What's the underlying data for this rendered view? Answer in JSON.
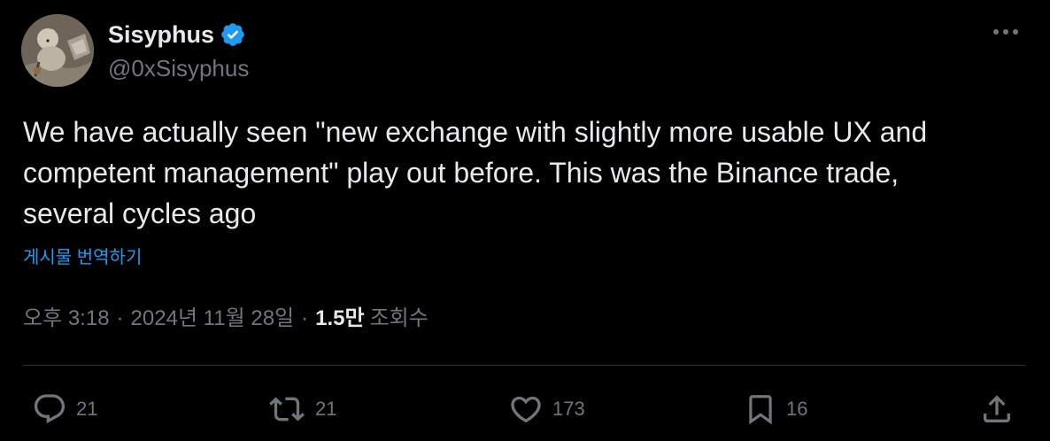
{
  "author": {
    "display_name": "Sisyphus",
    "handle": "@0xSisyphus",
    "verified": true,
    "avatar_icon": "avatar-illustration"
  },
  "tweet": {
    "text": "We have actually seen \"new exchange with slightly more usable UX and\ncompetent management\" play out before. This was the Binance trade,\nseveral cycles ago",
    "translate_label": "게시물 번역하기"
  },
  "meta": {
    "time": "오후 3:18",
    "separator": "·",
    "date": "2024년 11월 28일",
    "views_count": "1.5만",
    "views_label": "조회수"
  },
  "actions": {
    "reply_count": "21",
    "repost_count": "21",
    "like_count": "173",
    "bookmark_count": "16"
  },
  "colors": {
    "background": "#000000",
    "text_primary": "#e7e9ea",
    "text_secondary": "#71767b",
    "accent": "#1d9bf0",
    "divider": "#2f3336"
  },
  "icons": {
    "verified": "verified-badge-icon",
    "more": "more-options-icon",
    "reply": "reply-icon",
    "repost": "repost-icon",
    "like": "heart-icon",
    "bookmark": "bookmark-icon",
    "share": "share-icon"
  }
}
